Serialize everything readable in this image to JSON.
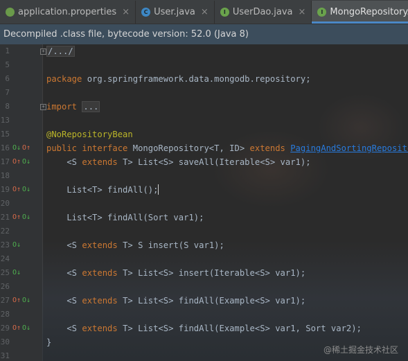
{
  "tabs": [
    {
      "label": "application.properties",
      "icon": "properties-file-icon",
      "icon_color": "#6a9a4a",
      "icon_glyph": "",
      "active": false
    },
    {
      "label": "User.java",
      "icon": "java-class-icon",
      "icon_color": "#3d87c4",
      "icon_glyph": "C",
      "active": false
    },
    {
      "label": "UserDao.java",
      "icon": "java-interface-icon",
      "icon_color": "#6aa34c",
      "icon_glyph": "I",
      "active": false
    },
    {
      "label": "MongoRepository.class",
      "icon": "java-interface-icon",
      "icon_color": "#6aa34c",
      "icon_glyph": "I",
      "active": true
    }
  ],
  "close_glyph": "×",
  "banner": {
    "text": "Decompiled .class file, bytecode version: 52.0 (Java 8)"
  },
  "editor": {
    "lines": [
      {
        "num": "1",
        "fold": "+",
        "segments": [
          {
            "t": "/.../",
            "c": "fold"
          }
        ]
      },
      {
        "num": "5",
        "segments": []
      },
      {
        "num": "6",
        "segments": [
          {
            "t": "package ",
            "c": "kw"
          },
          {
            "t": "org.springframework.data.mongodb.repository;",
            "c": ""
          }
        ]
      },
      {
        "num": "7",
        "segments": []
      },
      {
        "num": "8",
        "fold": "+",
        "segments": [
          {
            "t": "import ",
            "c": "kw"
          },
          {
            "t": "...",
            "c": "fold"
          }
        ]
      },
      {
        "num": "13",
        "segments": []
      },
      {
        "num": "15",
        "segments": [
          {
            "t": "@NoRepositoryBean",
            "c": "ann"
          }
        ]
      },
      {
        "num": "16",
        "marks": [
          "impl",
          "override"
        ],
        "segments": [
          {
            "t": "public interface ",
            "c": "kw"
          },
          {
            "t": "MongoRepository<T, ID> ",
            "c": ""
          },
          {
            "t": "extends ",
            "c": "kw"
          },
          {
            "t": "PagingAndSortingRepository",
            "c": "link"
          },
          {
            "t": "<",
            "c": ""
          }
        ]
      },
      {
        "num": "17",
        "marks": [
          "override",
          "impl"
        ],
        "segments": [
          {
            "t": "    <S ",
            "c": ""
          },
          {
            "t": "extends ",
            "c": "kw"
          },
          {
            "t": "T> List<S> saveAll(Iterable<S> var1);",
            "c": ""
          }
        ]
      },
      {
        "num": "18",
        "segments": []
      },
      {
        "num": "19",
        "marks": [
          "override",
          "impl"
        ],
        "caret": true,
        "segments": [
          {
            "t": "    List<T> findAll();",
            "c": ""
          }
        ]
      },
      {
        "num": "20",
        "segments": []
      },
      {
        "num": "21",
        "marks": [
          "override",
          "impl"
        ],
        "segments": [
          {
            "t": "    List<T> findAll(Sort var1);",
            "c": ""
          }
        ]
      },
      {
        "num": "22",
        "segments": []
      },
      {
        "num": "23",
        "marks": [
          "impl"
        ],
        "segments": [
          {
            "t": "    <S ",
            "c": ""
          },
          {
            "t": "extends ",
            "c": "kw"
          },
          {
            "t": "T> S insert(S var1);",
            "c": ""
          }
        ]
      },
      {
        "num": "24",
        "segments": []
      },
      {
        "num": "25",
        "marks": [
          "impl"
        ],
        "segments": [
          {
            "t": "    <S ",
            "c": ""
          },
          {
            "t": "extends ",
            "c": "kw"
          },
          {
            "t": "T> List<S> insert(Iterable<S> var1);",
            "c": ""
          }
        ]
      },
      {
        "num": "26",
        "segments": []
      },
      {
        "num": "27",
        "marks": [
          "override",
          "impl"
        ],
        "segments": [
          {
            "t": "    <S ",
            "c": ""
          },
          {
            "t": "extends ",
            "c": "kw"
          },
          {
            "t": "T> List<S> findAll(Example<S> var1);",
            "c": ""
          }
        ]
      },
      {
        "num": "28",
        "segments": []
      },
      {
        "num": "29",
        "marks": [
          "override",
          "impl"
        ],
        "segments": [
          {
            "t": "    <S ",
            "c": ""
          },
          {
            "t": "extends ",
            "c": "kw"
          },
          {
            "t": "T> List<S> findAll(Example<S> var1, Sort var2);",
            "c": ""
          }
        ]
      },
      {
        "num": "30",
        "segments": [
          {
            "t": "}",
            "c": ""
          }
        ]
      },
      {
        "num": "31",
        "segments": []
      }
    ]
  },
  "watermark": {
    "text": "@稀土掘金技术社区"
  },
  "colors": {
    "keyword": "#cc7832",
    "annotation": "#bbb529",
    "link": "#287bde",
    "text": "#a9b7c6",
    "implement_mark": "#4fb14f",
    "override_mark": "#d96b4a"
  },
  "mark_glyphs": {
    "impl": "O↓",
    "override": "O↑"
  }
}
